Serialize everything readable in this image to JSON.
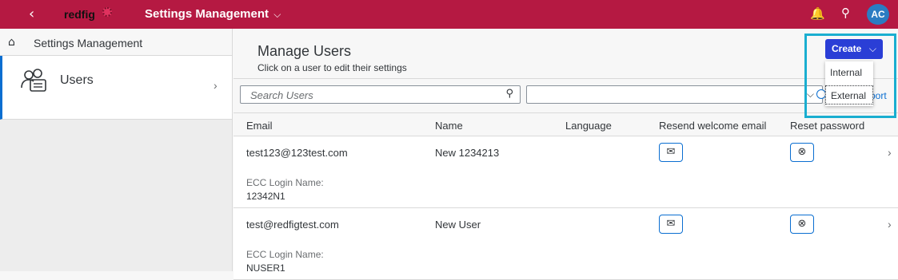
{
  "shell": {
    "back_glyph": "‹",
    "logo_text": "redfig",
    "app_title": "Settings Management",
    "title_chevron": "⌵",
    "bell_glyph": "🔔",
    "search_glyph": "⚲",
    "avatar_initials": "AC",
    "accent_color": "#b51942",
    "avatar_color": "#2b7cc2"
  },
  "sidebar": {
    "header_label": "Settings Management",
    "home_glyph": "⌂",
    "items": [
      {
        "label": "Users",
        "chevron": "›"
      }
    ]
  },
  "main": {
    "title": "Manage Users",
    "subtitle": "Click on a user to edit their settings",
    "search_placeholder": "Search Users",
    "search_glyph": "⚲",
    "select_chevron": "⌵",
    "export_label": "port"
  },
  "create": {
    "label": "Create",
    "chevron": "⌵",
    "menu": [
      "Internal",
      "External"
    ],
    "button_color": "#2a3ed6",
    "highlight_color": "#1aaed0"
  },
  "table": {
    "columns": [
      "Email",
      "Name",
      "Language",
      "Resend welcome email",
      "Reset password"
    ],
    "ecc_label": "ECC Login Name:",
    "mail_glyph": "✉",
    "reset_glyph": "⊗",
    "row_chevron": "›",
    "rows": [
      {
        "email": "test123@123test.com",
        "name": "New 1234213",
        "language": "",
        "ecc_login": "12342N1"
      },
      {
        "email": "test@redfigtest.com",
        "name": "New User",
        "language": "",
        "ecc_login": "NUSER1"
      }
    ]
  }
}
